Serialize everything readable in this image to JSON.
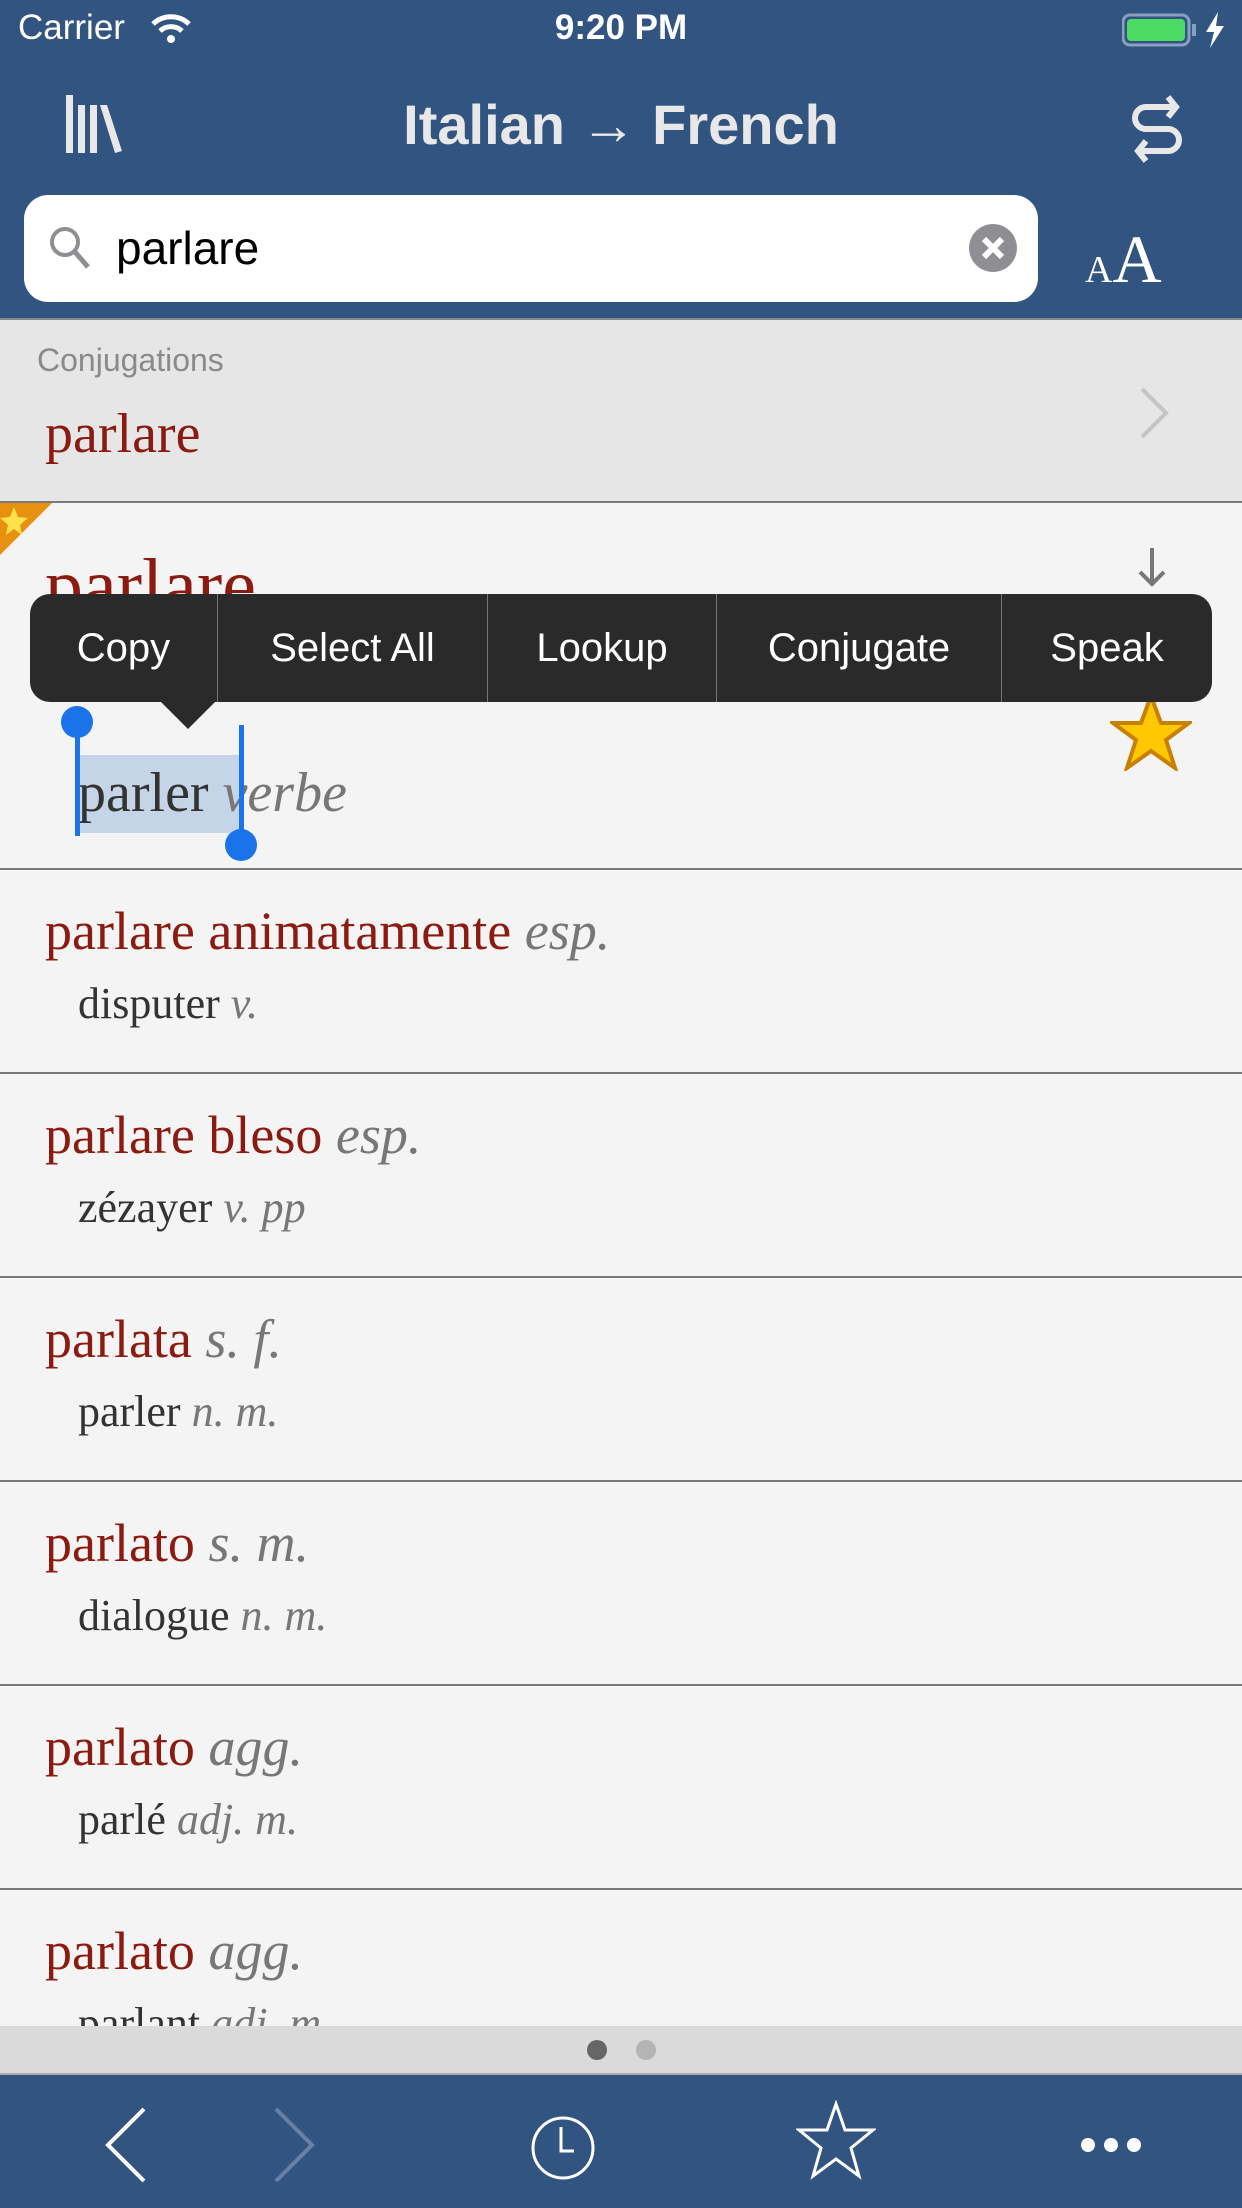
{
  "status_bar": {
    "carrier": "Carrier",
    "time": "9:20 PM",
    "battery_color": "#4cd964"
  },
  "header": {
    "title": "Italian → French",
    "left_icon": "library-icon",
    "right_icon": "swap-direction-icon",
    "bg_color": "#325480"
  },
  "search": {
    "value": "parlare",
    "font_size_button": "AA"
  },
  "conjugations": {
    "label": "Conjugations",
    "word": "parlare"
  },
  "entry": {
    "headword": "parlare",
    "translation": "parler",
    "pos": "verbe",
    "favorited": true
  },
  "context_menu": {
    "items": [
      "Copy",
      "Select All",
      "Lookup",
      "Conjugate",
      "Speak"
    ]
  },
  "results": [
    {
      "headword": "parlare animatamente",
      "pos": "esp.",
      "translation": "disputer",
      "tpos": "v."
    },
    {
      "headword": "parlare bleso",
      "pos": "esp.",
      "translation": "zézayer",
      "tpos": "v. pp"
    },
    {
      "headword": "parlata",
      "pos": "s. f.",
      "translation": "parler",
      "tpos": "n. m."
    },
    {
      "headword": "parlato",
      "pos": "s. m.",
      "translation": "dialogue",
      "tpos": "n. m."
    },
    {
      "headword": "parlato",
      "pos": "agg.",
      "translation": "parlé",
      "tpos": "adj. m."
    },
    {
      "headword": "parlato",
      "pos": "agg.",
      "translation": "parlant",
      "tpos": "adj. m."
    }
  ],
  "page_indicator": {
    "pages": 2,
    "current": 1
  },
  "tabbar": {
    "items": [
      "back-icon",
      "forward-icon",
      "history-icon",
      "favorites-icon",
      "more-icon"
    ]
  }
}
